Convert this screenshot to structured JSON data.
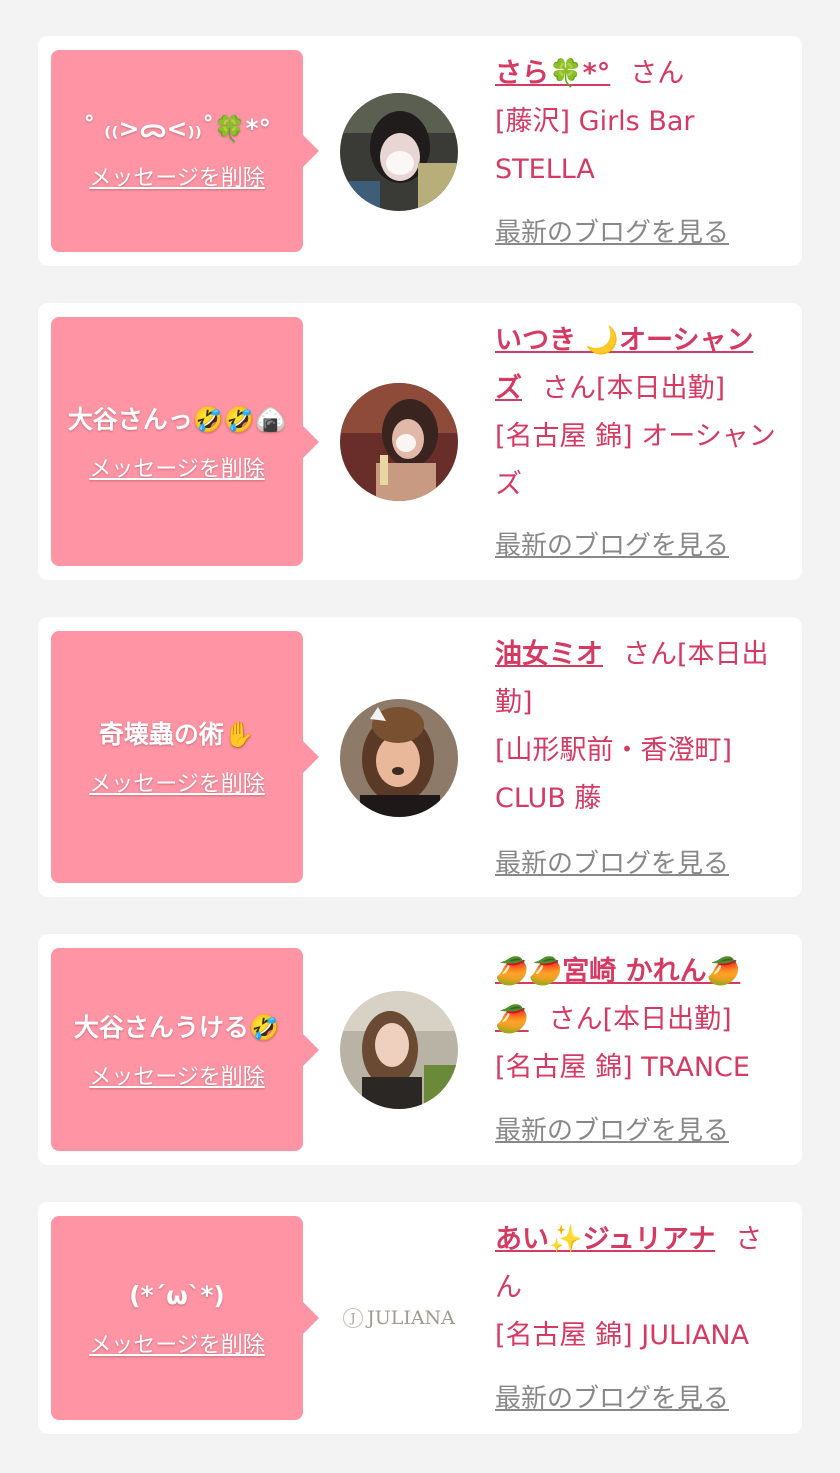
{
  "favorites": [
    {
      "message": "˚ ₍₍>ᯅ<₎₎˚🍀*°",
      "delete_label": "メッセージを削除",
      "girl_name": "さら🍀*°",
      "honorific": "さん",
      "shop_line": "[藤沢] Girls Bar STELLA",
      "blog_label": "最新のブログを見る",
      "avatar": "girl-photo"
    },
    {
      "message": "大谷さんっ🤣🤣🍙",
      "delete_label": "メッセージを削除",
      "girl_name": "いつき 🌙オーシャンズ",
      "honorific": "さん[本日出勤]",
      "shop_line": "[名古屋 錦] オーシャンズ",
      "blog_label": "最新のブログを見る",
      "avatar": "girl-photo"
    },
    {
      "message": "奇壊蟲の術✋",
      "delete_label": "メッセージを削除",
      "girl_name": "油女ミオ",
      "honorific": "さん[本日出勤]",
      "shop_line": "[山形駅前・香澄町] CLUB 藤",
      "blog_label": "最新のブログを見る",
      "avatar": "girl-photo"
    },
    {
      "message": "大谷さんうける🤣",
      "delete_label": "メッセージを削除",
      "girl_name": "🥭🥭宮崎 かれん🥭🥭",
      "honorific": "さん[本日出勤]",
      "shop_line": "[名古屋 錦] TRANCE",
      "blog_label": "最新のブログを見る",
      "avatar": "girl-photo"
    },
    {
      "message": "(*´ω`*)",
      "delete_label": "メッセージを削除",
      "girl_name": "あい✨ジュリアナ",
      "honorific": "さん",
      "shop_line": "[名古屋 錦] JULIANA",
      "blog_label": "最新のブログを見る",
      "avatar": "shop-logo",
      "logo_text": "JULIANA"
    }
  ],
  "colors": {
    "page_background": "#f3f3f3",
    "bubble_pink": "#ff94a4",
    "accent_text": "#d53a63",
    "link_gray": "#888888"
  }
}
